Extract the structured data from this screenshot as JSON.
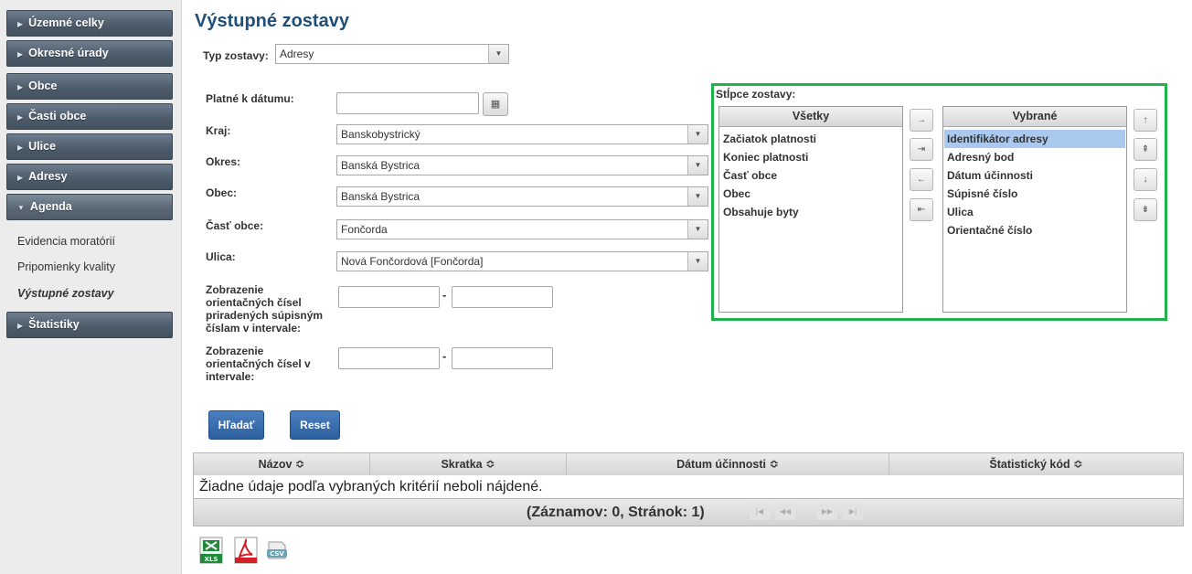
{
  "sidebar": {
    "items": [
      {
        "label": "Územné celky"
      },
      {
        "label": "Okresné úrady"
      },
      {
        "label": "Obce"
      },
      {
        "label": "Časti obce"
      },
      {
        "label": "Ulice"
      },
      {
        "label": "Adresy"
      },
      {
        "label": "Agenda"
      },
      {
        "label": "Štatistiky"
      }
    ],
    "agenda_subitems": [
      {
        "label": "Evidencia moratórií"
      },
      {
        "label": "Pripomienky kvality"
      },
      {
        "label": "Výstupné zostavy"
      }
    ]
  },
  "page_title": "Výstupné zostavy",
  "form": {
    "report_type_label": "Typ zostavy:",
    "report_type_value": "Adresy",
    "valid_date_label": "Platné k dátumu:",
    "valid_date_value": "",
    "region_label": "Kraj:",
    "region_value": "Banskobystrický",
    "district_label": "Okres:",
    "district_value": "Banská Bystrica",
    "municipality_label": "Obec:",
    "municipality_value": "Banská Bystrica",
    "municipality_part_label": "Časť obce:",
    "municipality_part_value": "Fončorda",
    "street_label": "Ulica:",
    "street_value": "Nová Fončordová [Fončorda]",
    "range1_label": [
      "Zobrazenie",
      "orientačných čísel",
      "priradených súpisným",
      "číslam v intervale:"
    ],
    "range2_label": [
      "Zobrazenie",
      "orientačných čísel v",
      "intervale:"
    ],
    "range1_from": "",
    "range1_to": "",
    "range2_from": "",
    "range2_to": "",
    "dash": "-"
  },
  "buttons": {
    "search": "Hľadať",
    "reset": "Reset"
  },
  "columns": {
    "panel_label": "Stĺpce zostavy:",
    "all_header": "Všetky",
    "selected_header": "Vybrané",
    "all_items": [
      "Začiatok platnosti",
      "Koniec platnosti",
      "Časť obce",
      "Obec",
      "Obsahuje byty"
    ],
    "selected_items": [
      "Identifikátor adresy",
      "Adresný bod",
      "Dátum účinnosti",
      "Súpisné číslo",
      "Ulica",
      "Orientačné číslo"
    ],
    "selected_highlight_index": 0
  },
  "table": {
    "headers": [
      "Názov ≎",
      "Skratka ≎",
      "Dátum účinnosti ≎",
      "Štatistický kód ≎"
    ],
    "empty_message": "Žiadne údaje podľa vybraných kritérií neboli nájdené.",
    "pager_text": "(Záznamov: 0, Stránok: 1)"
  },
  "exports": [
    "xls-icon",
    "pdf-icon",
    "csv-icon"
  ],
  "colors": {
    "title": "#1f4e79",
    "nav": "#4d5c6b",
    "panel_border": "#22b14c",
    "primary_button": "#2c5f9e",
    "selection": "#a9c9ee"
  }
}
